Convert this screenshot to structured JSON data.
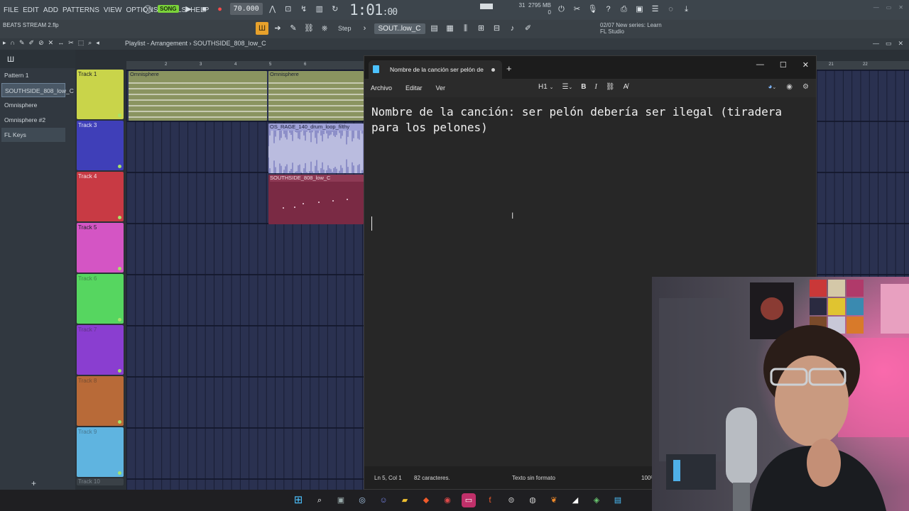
{
  "fl_menu": [
    "FILE",
    "EDIT",
    "ADD",
    "PATTERNS",
    "VIEW",
    "OPTIONS",
    "TOOLS",
    "HELP"
  ],
  "transport": {
    "song_label": "SONG",
    "tempo": "70.000",
    "time_main": "1:01",
    "time_sub": ":00"
  },
  "cpu": {
    "value": "31",
    "memory": "2795 MB",
    "voices": "0"
  },
  "project_name": "BEATS STREAM 2.flp",
  "toolbar2": {
    "step_label": "Step",
    "pattern_select": "SOUT..low_C"
  },
  "hint": {
    "line1": "02/07  New series: Learn",
    "line2": "FL Studio"
  },
  "playlist_title": "Playlist - Arrangement  ›  SOUTHSIDE_808_low_C",
  "picker": [
    "Pattern 1",
    "SOUTHSIDE_808_low_C",
    "Omnisphere",
    "Omnisphere #2",
    "FL Keys"
  ],
  "tracks": [
    "Track 1",
    "Track 3",
    "Track 4",
    "Track 5",
    "Track 6",
    "Track 7",
    "Track 8",
    "Track 9",
    "Track 10"
  ],
  "ruler_left": [
    "2",
    "3",
    "4",
    "5",
    "6"
  ],
  "ruler_right": [
    "21",
    "22"
  ],
  "clips": {
    "omni_1": "Omnisphere",
    "omni_2": "Omnisphere",
    "drum_loop": "OS_RAGE_140_drum_loop_filthy",
    "c808": "SOUTHSIDE_808_low_C"
  },
  "notepad": {
    "tab_title": "Nombre de la canción ser pelón de",
    "menus": [
      "Archivo",
      "Editar",
      "Ver"
    ],
    "heading_select": "H1",
    "text_line1": "Nombre de la canción: ser pelón debería ser ilegal (tiradera",
    "text_line2": "para los pelones)",
    "status_position": "Ln 5, Col 1",
    "status_chars": "82 caracteres.",
    "status_format": "Texto sin formato",
    "status_zoom": "100%"
  },
  "colors": {
    "track_1": "#c9d44a",
    "track_3": "#3f3fb8",
    "track_4": "#c83a44",
    "track_5": "#d455c4",
    "track_6": "#56d660",
    "track_7": "#8a3ed0",
    "track_8": "#b86a38",
    "track_9": "#5fb4e0"
  }
}
